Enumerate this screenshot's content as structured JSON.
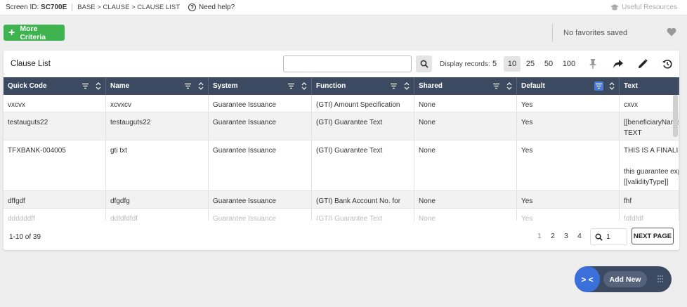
{
  "topbar": {
    "screen_id_label": "Screen ID:",
    "screen_id": "SC700E",
    "breadcrumb": "BASE > CLAUSE > CLAUSE LIST",
    "help": "Need help?",
    "resources": "Useful Resources"
  },
  "criteria": {
    "more_label": "More Criteria"
  },
  "favorites": {
    "text": "No favorites saved"
  },
  "list": {
    "title": "Clause List",
    "search_value": "",
    "display_label": "Display records:",
    "records": [
      "5",
      "10",
      "25",
      "50",
      "100"
    ],
    "records_selected": "10"
  },
  "columns": [
    "Quick Code",
    "Name",
    "System",
    "Function",
    "Shared",
    "Default",
    "Text"
  ],
  "rows": [
    {
      "quick_code": "vxcvx",
      "name": "xcvxcv",
      "system": "Guarantee Issuance",
      "function": "(GTI) Amount Specification",
      "shared": "None",
      "default": "Yes",
      "text": [
        "cxvx"
      ]
    },
    {
      "quick_code": "testauguts22",
      "name": "testauguts22",
      "system": "Guarantee Issuance",
      "function": "(GTI) Guarantee Text",
      "shared": "None",
      "default": "Yes",
      "text": [
        "[[beneficiaryNameAr",
        "TEXT"
      ]
    },
    {
      "quick_code": "TFXBANK-004005",
      "name": "gti txt",
      "system": "Guarantee Issuance",
      "function": "(GTI) Guarantee Text",
      "shared": "None",
      "default": "Yes",
      "text": [
        "THIS IS A FINALISED",
        "",
        "this guarantee expire",
        "[[validityType]]"
      ]
    },
    {
      "quick_code": "dffgdf",
      "name": "dfgdfg",
      "system": "Guarantee Issuance",
      "function": "(GTI) Bank Account No. for Liability",
      "shared": "None",
      "default": "Yes",
      "text": [
        "fhf"
      ]
    },
    {
      "quick_code": "ddddddff",
      "name": "ddfdfdfdf",
      "system": "Guarantee Issuance",
      "function": "(GTI) Guarantee Text",
      "shared": "None",
      "default": "Yes",
      "text": [
        "fdfdfdf"
      ]
    }
  ],
  "pagination": {
    "summary": "1-10 of 39",
    "pages": [
      "1",
      "2",
      "3",
      "4"
    ],
    "current_page": "1",
    "goto_value": "1",
    "next_label": "NEXT PAGE"
  },
  "add_new": {
    "label": "Add New",
    "toggle_label": "> <"
  },
  "colors": {
    "green": "#3fb34f",
    "header": "#3c4a61",
    "accent": "#3b6fd9"
  },
  "icons": [
    "help-circle-icon",
    "graduation-cap-icon",
    "plus-icon",
    "heart-icon",
    "search-icon",
    "pin-icon",
    "share-arrow-icon",
    "pencil-icon",
    "history-icon",
    "filter-icon",
    "sort-icon",
    "grip-icon"
  ]
}
